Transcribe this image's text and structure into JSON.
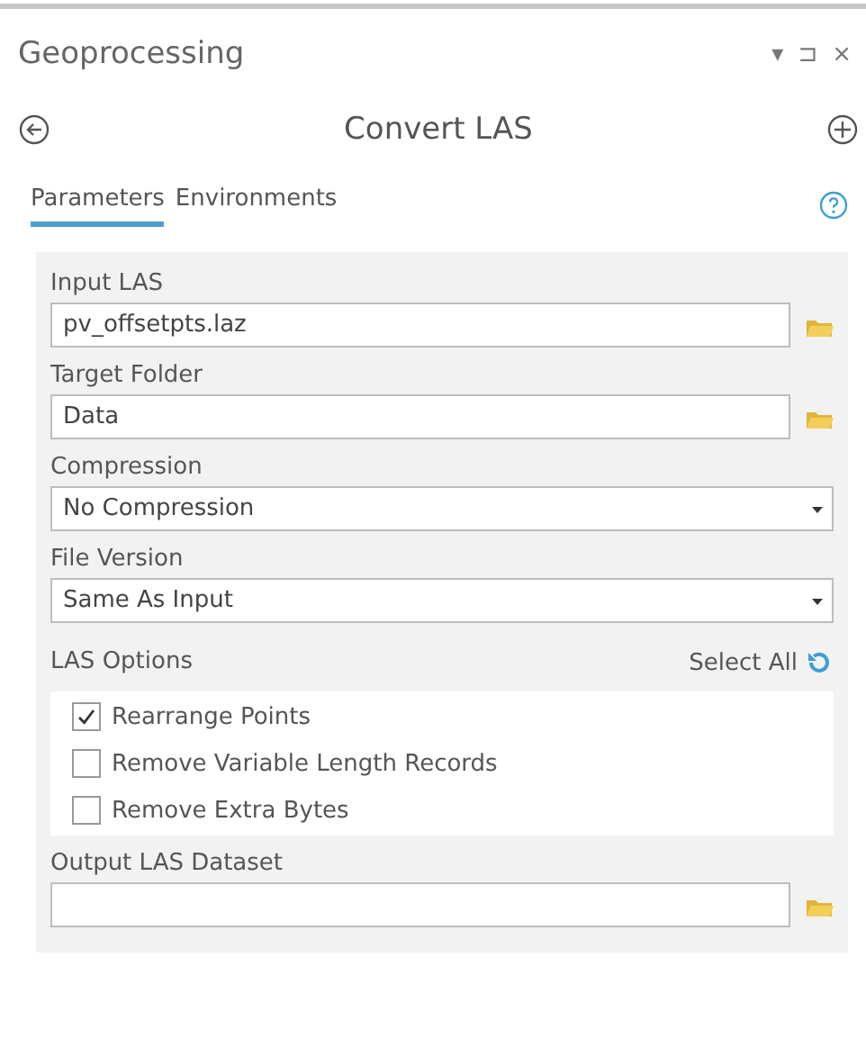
{
  "pane": {
    "title": "Geoprocessing",
    "controls": [
      "▾",
      "⊐",
      "×"
    ]
  },
  "tool": {
    "title": "Convert LAS"
  },
  "tabs": [
    {
      "label": "Parameters",
      "selected": true
    },
    {
      "label": "Environments",
      "selected": false
    }
  ],
  "parameters": [
    {
      "kind": "file",
      "label": "Input LAS",
      "value": "pv_offsetpts.laz"
    },
    {
      "kind": "file",
      "label": "Target Folder",
      "value": "Data"
    },
    {
      "kind": "dropdown",
      "label": "Compression",
      "value": "No Compression"
    },
    {
      "kind": "dropdown",
      "label": "File Version",
      "value": "Same As Input"
    },
    {
      "kind": "checklist",
      "label": "LAS Options",
      "action": "Select All",
      "options": [
        {
          "label": "Rearrange Points",
          "checked": true
        },
        {
          "label": "Remove Variable Length Records",
          "checked": false
        },
        {
          "label": "Remove Extra Bytes",
          "checked": false
        }
      ]
    },
    {
      "kind": "file",
      "label": "Output LAS Dataset"
    }
  ]
}
